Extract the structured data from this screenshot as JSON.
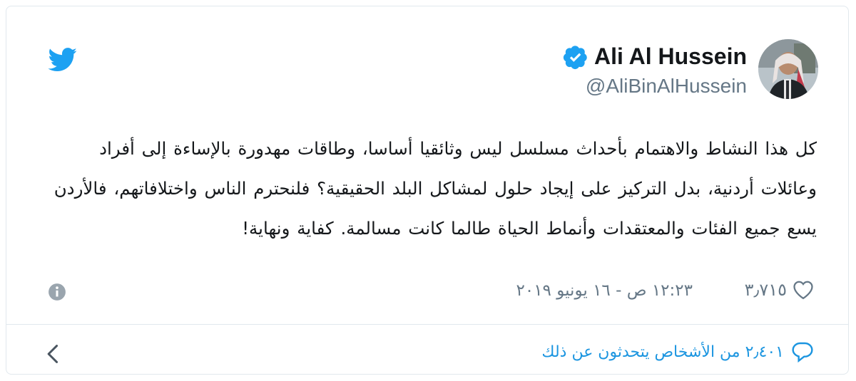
{
  "tweet": {
    "display_name": "Ali Al Hussein",
    "handle": "@AliBinAlHussein",
    "text": "كل هذا النشاط والاهتمام بأحداث مسلسل ليس وثائقيا أساسا، وطاقات مهدورة بالإساءة إلى أفراد وعائلات أردنية، بدل التركيز على إيجاد حلول لمشاكل البلد الحقيقية؟ فلنحترم الناس واختلافاتهم، فالأردن يسع جميع الفئات والمعتقدات وأنماط الحياة طالما كانت مسالمة. كفاية ونهاية!",
    "likes": "٣٫٧١٥",
    "timestamp": "١٢:٢٣ ص - ١٦ يونيو ٢٠١٩",
    "replies_text": "٢٫٤٠١ من الأشخاص يتحدثون عن ذلك"
  },
  "icons": {
    "brand": "twitter-bird-icon",
    "verified": "verified-badge-icon",
    "like": "heart-icon",
    "info": "info-icon",
    "reply": "comment-icon",
    "nav": "chevron-left-icon"
  },
  "colors": {
    "twitter_blue": "#1da1f2",
    "link_blue": "#1b95e0",
    "text": "#14171a",
    "muted": "#657786",
    "border": "#e1e8ed"
  }
}
